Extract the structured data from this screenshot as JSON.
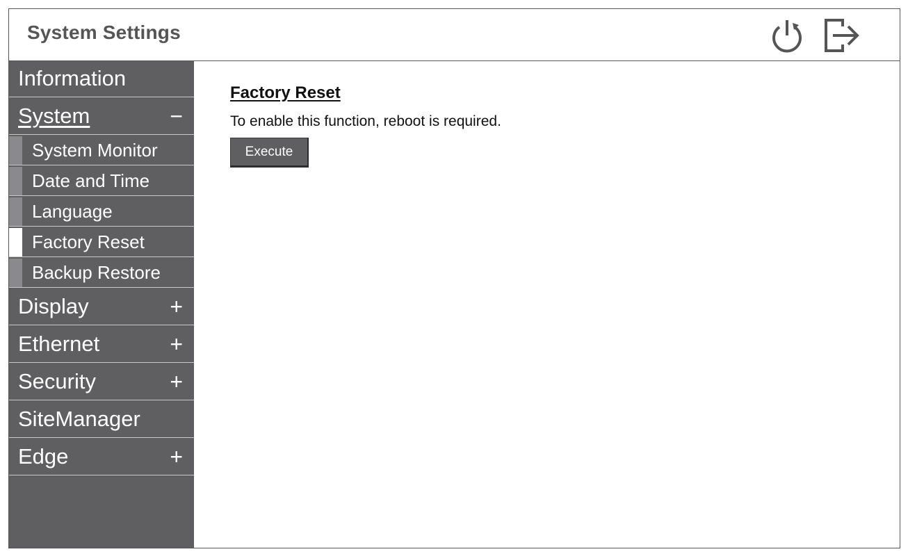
{
  "app": {
    "title": "System Settings"
  },
  "header": {
    "icons": [
      {
        "name": "power-icon"
      },
      {
        "name": "logout-icon"
      }
    ]
  },
  "sidebar": {
    "items": [
      {
        "label": "Information"
      },
      {
        "label": "System",
        "toggle": "−",
        "expanded": true,
        "children": [
          {
            "label": "System Monitor"
          },
          {
            "label": "Date and Time"
          },
          {
            "label": "Language"
          },
          {
            "label": "Factory Reset",
            "active": true
          },
          {
            "label": "Backup Restore"
          }
        ]
      },
      {
        "label": "Display",
        "toggle": "+"
      },
      {
        "label": "Ethernet",
        "toggle": "+"
      },
      {
        "label": "Security",
        "toggle": "+"
      },
      {
        "label": "SiteManager"
      },
      {
        "label": "Edge",
        "toggle": "+"
      }
    ]
  },
  "main": {
    "title": "Factory Reset",
    "description": "To enable this function, reboot is required.",
    "execute_label": "Execute"
  },
  "colors": {
    "sidebar_bg": "#5f5f62",
    "sidebar_marker": "#8a8a8e",
    "active_marker": "#ffffff",
    "title_text": "#555555"
  }
}
